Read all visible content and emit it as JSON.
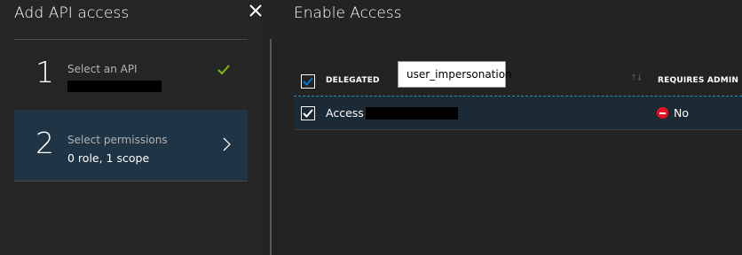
{
  "left_blade": {
    "title": "Add API access",
    "steps": [
      {
        "number": "1",
        "label": "Select an API",
        "value": "",
        "status": "complete"
      },
      {
        "number": "2",
        "label": "Select permissions",
        "value": "0 role, 1 scope",
        "status": "active"
      }
    ]
  },
  "right_blade": {
    "title": "Enable Access",
    "columns": {
      "delegated": "DELEGATED",
      "requires_admin": "REQUIRES ADMIN"
    },
    "tooltip": "user_impersonation",
    "rows": [
      {
        "name": "Access",
        "requires_admin": "No",
        "checked": true
      }
    ]
  },
  "colors": {
    "active_step_bg": "#1f3445",
    "check_green": "#7fba00",
    "accent_blue": "#0078d7",
    "no_red": "#e81123"
  }
}
